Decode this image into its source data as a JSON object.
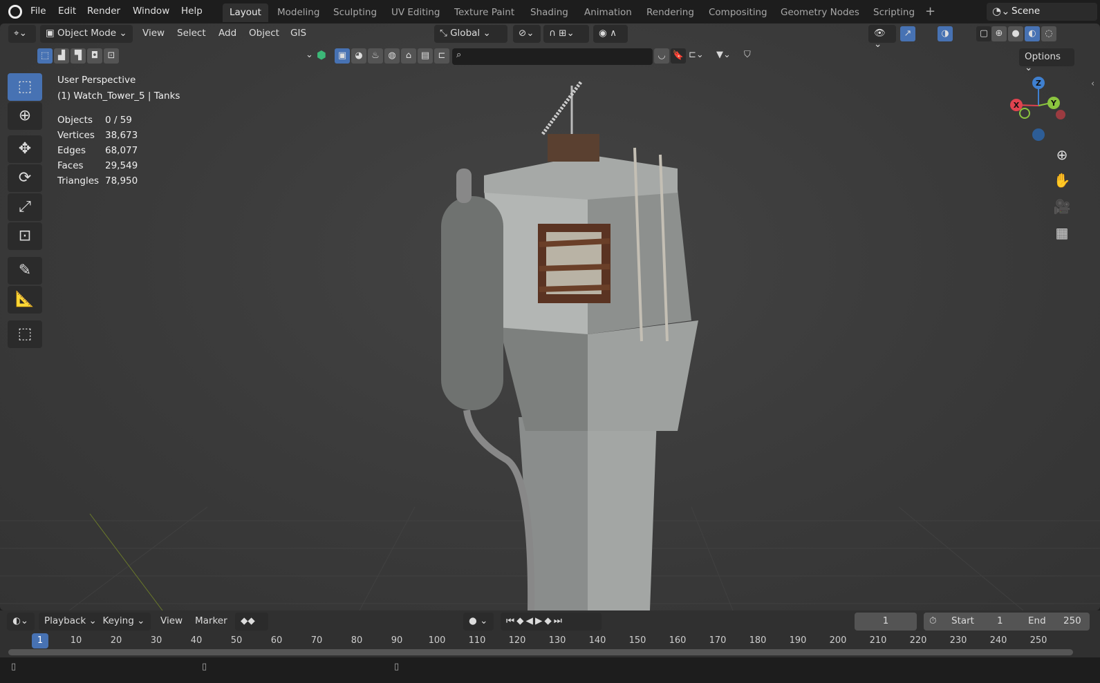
{
  "topbar": {
    "menus": [
      "File",
      "Edit",
      "Render",
      "Window",
      "Help"
    ],
    "workspaces": [
      "Layout",
      "Modeling",
      "Sculpting",
      "UV Editing",
      "Texture Paint",
      "Shading",
      "Animation",
      "Rendering",
      "Compositing",
      "Geometry Nodes",
      "Scripting"
    ],
    "active_workspace": "Layout",
    "add_workspace": "+",
    "scene": "Scene"
  },
  "header": {
    "mode": "Object Mode",
    "menus": [
      "View",
      "Select",
      "Add",
      "Object",
      "GIS"
    ],
    "transform_orientation": "Global",
    "options": "Options"
  },
  "overlay": {
    "perspective": "User Perspective",
    "object": "(1) Watch_Tower_5 | Tanks",
    "stats": [
      {
        "label": "Objects",
        "value": "0 / 59"
      },
      {
        "label": "Vertices",
        "value": "38,673"
      },
      {
        "label": "Edges",
        "value": "68,077"
      },
      {
        "label": "Faces",
        "value": "29,549"
      },
      {
        "label": "Triangles",
        "value": "78,950"
      }
    ]
  },
  "gizmo": {
    "x": "X",
    "y": "Y",
    "z": "Z",
    "x_color": "#e0434f",
    "y_color": "#8bc53f",
    "z_color": "#3f80d0"
  },
  "timeline": {
    "menus": [
      "Playback",
      "Keying",
      "View",
      "Marker"
    ],
    "current_frame": "1",
    "start_label": "Start",
    "start": "1",
    "end_label": "End",
    "end": "250",
    "ticks": [
      "10",
      "20",
      "30",
      "40",
      "50",
      "60",
      "70",
      "80",
      "90",
      "100",
      "110",
      "120",
      "130",
      "140",
      "150",
      "160",
      "170",
      "180",
      "190",
      "200",
      "210",
      "220",
      "230",
      "240",
      "250"
    ],
    "playhead": "1"
  },
  "colors": {
    "accent": "#4772b3"
  }
}
